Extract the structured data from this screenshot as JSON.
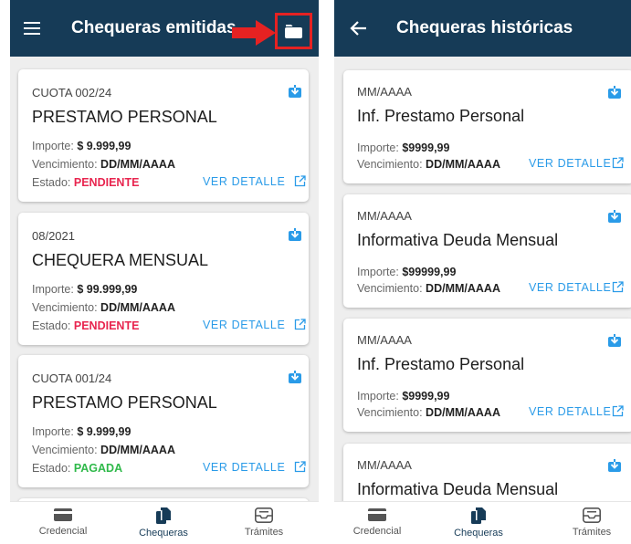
{
  "left": {
    "title": "Chequeras emitidas",
    "cards": [
      {
        "period": "CUOTA 002/24",
        "name": "PRESTAMO PERSONAL",
        "importe_label": "Importe: ",
        "importe": "$ 9.999,99",
        "venc_label": "Vencimiento: ",
        "venc": "DD/MM/AAAA",
        "estado_label": "Estado: ",
        "estado": "PENDIENTE",
        "detalle": "VER DETALLE"
      },
      {
        "period": "08/2021",
        "name": "CHEQUERA MENSUAL",
        "importe_label": "Importe: ",
        "importe": "$ 99.999,99",
        "venc_label": "Vencimiento: ",
        "venc": "DD/MM/AAAA",
        "estado_label": "Estado: ",
        "estado": "PENDIENTE",
        "detalle": "VER DETALLE"
      },
      {
        "period": "CUOTA 001/24",
        "name": "PRESTAMO PERSONAL",
        "importe_label": "Importe: ",
        "importe": "$ 9.999,99",
        "venc_label": "Vencimiento: ",
        "venc": "DD/MM/AAAA",
        "estado_label": "Estado: ",
        "estado": "PAGADA",
        "detalle": "VER DETALLE"
      }
    ]
  },
  "right": {
    "title": "Chequeras históricas",
    "cards": [
      {
        "period": "MM/AAAA",
        "name": "Inf. Prestamo Personal",
        "importe_label": "Importe: ",
        "importe": "$9999,99",
        "venc_label": "Vencimiento: ",
        "venc": "DD/MM/AAAA",
        "detalle": "VER DETALLE"
      },
      {
        "period": "MM/AAAA",
        "name": "Informativa Deuda Mensual",
        "importe_label": "Importe: ",
        "importe": "$99999,99",
        "venc_label": "Vencimiento: ",
        "venc": "DD/MM/AAAA",
        "detalle": "VER DETALLE"
      },
      {
        "period": "MM/AAAA",
        "name": "Inf. Prestamo Personal",
        "importe_label": "Importe: ",
        "importe": "$9999,99",
        "venc_label": "Vencimiento: ",
        "venc": "DD/MM/AAAA",
        "detalle": "VER DETALLE"
      },
      {
        "period": "MM/AAAA",
        "name": "Informativa Deuda Mensual"
      }
    ]
  },
  "nav": {
    "credencial": "Credencial",
    "chequeras": "Chequeras",
    "tramites": "Trámites"
  },
  "colors": {
    "appbar": "#163b57",
    "accent": "#2a9be8",
    "pending": "#e8254f",
    "paid": "#2fb94a",
    "highlight": "#e52222"
  },
  "icons": [
    "menu-icon",
    "arrow-right-icon",
    "folder-icon",
    "back-arrow-icon",
    "download-icon",
    "external-link-icon",
    "credit-card-icon",
    "documents-icon",
    "inbox-icon"
  ]
}
